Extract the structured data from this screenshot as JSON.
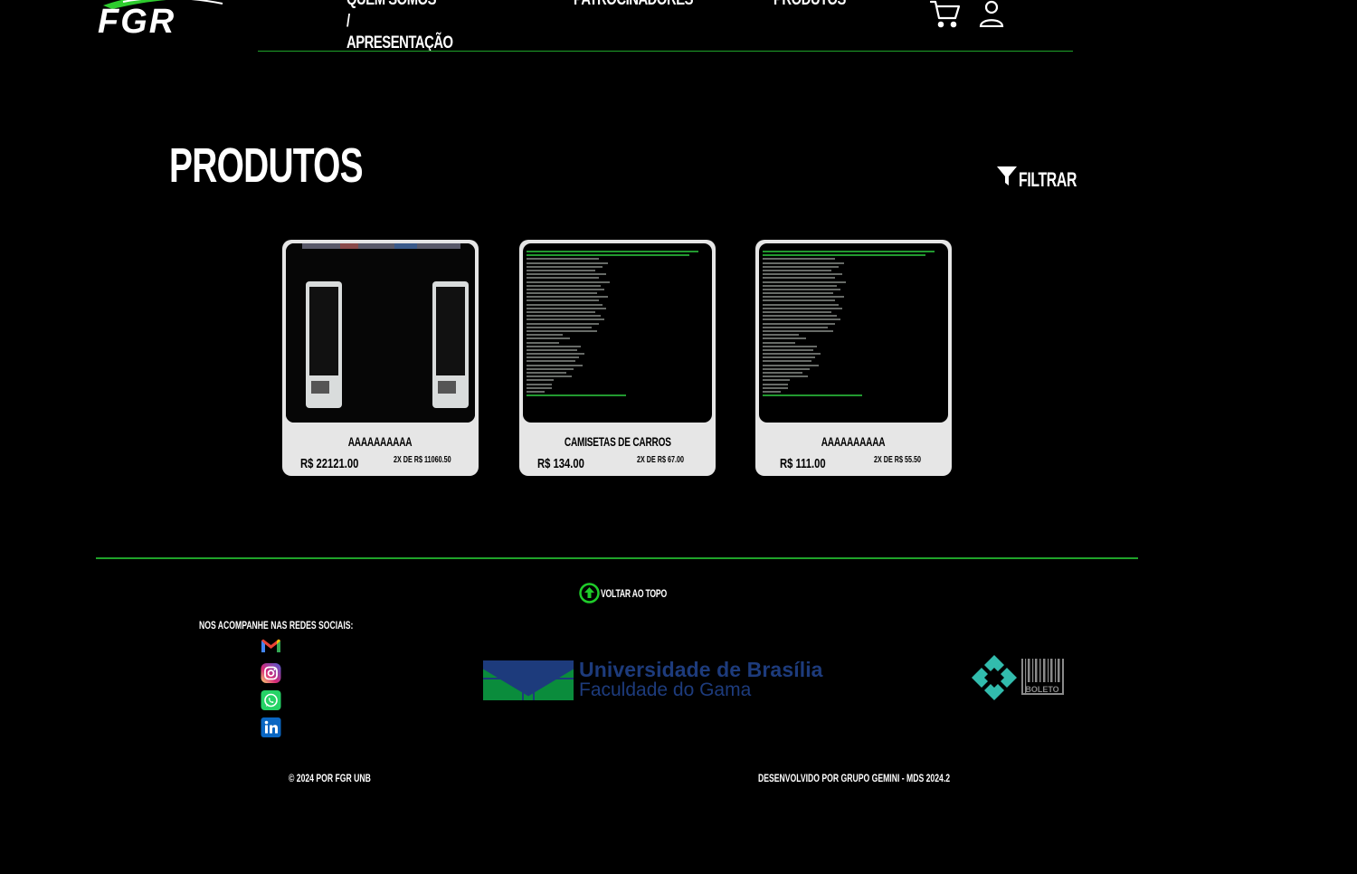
{
  "header": {
    "logo_text": "FGR",
    "nav": [
      {
        "label": "Quem somos / Apresentação"
      },
      {
        "label": "Patrocinadores"
      },
      {
        "label": "Produtos"
      }
    ]
  },
  "main": {
    "title": "Produtos",
    "filter_label": "Filtrar",
    "products": [
      {
        "name": "aaaaaaaaaa",
        "price": "R$ 22121.00",
        "installments": "2x de R$ 11060.50"
      },
      {
        "name": "Camisetas de carros",
        "price": "R$ 134.00",
        "installments": "2x de R$ 67.00"
      },
      {
        "name": "aaaaaaaaaa",
        "price": "R$ 111.00",
        "installments": "2x de R$ 55.50"
      }
    ]
  },
  "footer": {
    "back_to_top": "Voltar ao topo",
    "social_title": "Nos acompanhe nas redes sociais:",
    "social_links": [
      "gmail-icon",
      "instagram-icon",
      "whatsapp-icon",
      "linkedin-icon"
    ],
    "unb_title": "Universidade de Brasília",
    "unb_subtitle": "Faculdade do Gama",
    "boleto_text": "BOLETO",
    "copyright": "© 2024 por FGR UnB",
    "developed_by": "Desenvolvido por Grupo Gemini - MDS 2024.2"
  },
  "colors": {
    "background": "#000000",
    "accent_green": "#1fa32a",
    "card_bg": "#e6e6e6",
    "unb_blue": "#1d3b7c",
    "unb_green": "#0a8c3c",
    "pix_teal": "#32bcad"
  }
}
